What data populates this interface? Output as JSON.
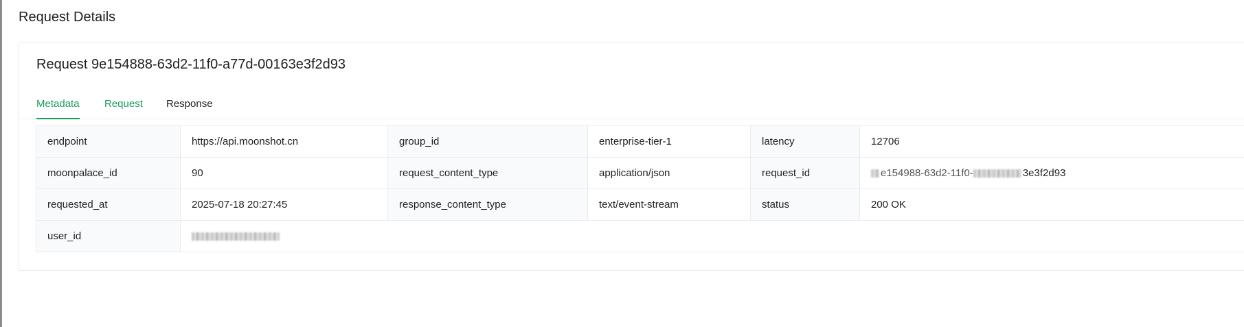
{
  "page": {
    "title": "Request Details"
  },
  "request": {
    "title": "Request 9e154888-63d2-11f0-a77d-00163e3f2d93"
  },
  "tabs": [
    {
      "label": "Metadata",
      "active": true
    },
    {
      "label": "Request",
      "active": false
    },
    {
      "label": "Response",
      "active": false
    }
  ],
  "metadata": {
    "rows": [
      [
        {
          "key": "endpoint",
          "value": "https://api.moonshot.cn"
        },
        {
          "key": "group_id",
          "value": "enterprise-tier-1"
        },
        {
          "key": "latency",
          "value": "12706"
        }
      ],
      [
        {
          "key": "moonpalace_id",
          "value": "90"
        },
        {
          "key": "request_content_type",
          "value": "application/json"
        },
        {
          "key": "request_id",
          "value": "e154988-63d2-11f0-",
          "value_suffix": "3e3f2d93"
        }
      ],
      [
        {
          "key": "requested_at",
          "value": "2025-07-18 20:27:45"
        },
        {
          "key": "response_content_type",
          "value": "text/event-stream"
        },
        {
          "key": "status",
          "value": "200 OK"
        }
      ],
      [
        {
          "key": "user_id",
          "value": ""
        }
      ]
    ]
  },
  "colors": {
    "accent": "#1b9a5b",
    "key_cell_bg": "#f9fafb",
    "border": "#ebebeb"
  }
}
